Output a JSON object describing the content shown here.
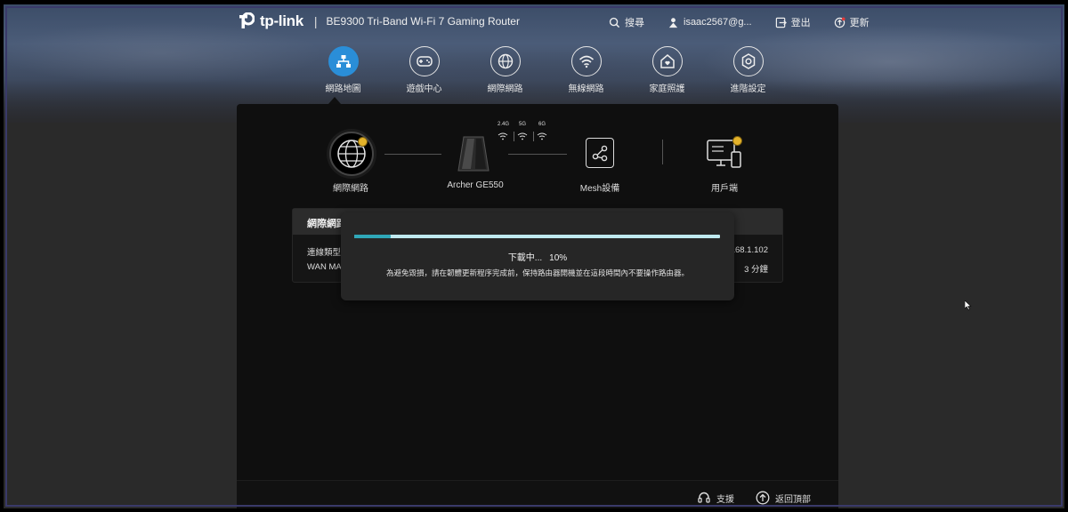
{
  "header": {
    "brand": "tp-link",
    "product_name": "BE9300 Tri-Band Wi-Fi 7 Gaming Router",
    "actions": [
      {
        "label": "搜尋",
        "icon": "search-icon"
      },
      {
        "label": "isaac2567@g...",
        "icon": "user-icon"
      },
      {
        "label": "登出",
        "icon": "logout-icon"
      },
      {
        "label": "更新",
        "icon": "update-icon"
      }
    ]
  },
  "nav": {
    "items": [
      {
        "label": "網路地圖",
        "icon": "network-map-icon",
        "active": true
      },
      {
        "label": "遊戲中心",
        "icon": "gamepad-icon",
        "active": false
      },
      {
        "label": "網際網路",
        "icon": "globe-icon",
        "active": false
      },
      {
        "label": "無線網路",
        "icon": "wifi-icon",
        "active": false
      },
      {
        "label": "家庭照護",
        "icon": "home-care-icon",
        "active": false
      },
      {
        "label": "進階設定",
        "icon": "gear-icon",
        "active": false
      }
    ]
  },
  "topology": {
    "internet_label": "網際網路",
    "router_label": "Archer GE550",
    "mesh_label": "Mesh設備",
    "clients_label": "用戶端",
    "bands": [
      "2.4G",
      "5G",
      "6G"
    ]
  },
  "info_card": {
    "title": "網際網路",
    "rows": [
      {
        "label": "連線類型",
        "value": "168.1.102"
      },
      {
        "label": "WAN MAC",
        "value": "3 分鐘"
      }
    ]
  },
  "modal": {
    "status_text": "下載中...",
    "percent_text": "10%",
    "progress": 0.1,
    "note": "為避免毀損，請在韌體更新程序完成前，保持路由器開機並在這段時間內不要操作路由器。"
  },
  "footer": {
    "support_label": "支援",
    "back_to_top_label": "返回頂部"
  },
  "colors": {
    "accent": "#2a8ed8",
    "progress_fill": "#2fa7b8",
    "progress_track": "#bfe9ef",
    "badge": "#e3b22a"
  }
}
